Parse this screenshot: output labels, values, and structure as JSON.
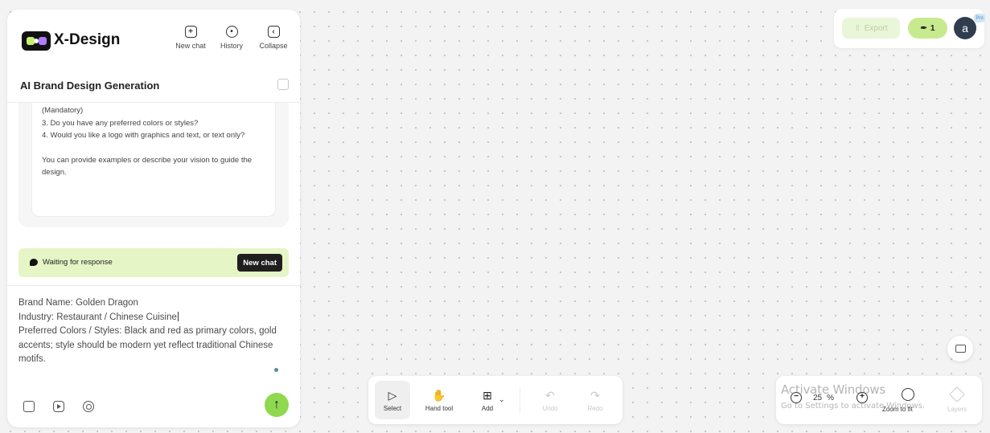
{
  "header": {
    "brand": "X-Design",
    "new_chat": "New chat",
    "history": "History",
    "collapse": "Collapse"
  },
  "conversation": {
    "title": "AI Brand Design Generation",
    "message_lines": [
      "(Mandatory)",
      "3. Do you have any preferred colors or styles?",
      "4. Would you like a logo with graphics and text, or text only?",
      "",
      "You can provide examples or describe your vision to guide the design."
    ]
  },
  "status": {
    "text": "Waiting for response",
    "new_chat_button": "New chat"
  },
  "input": {
    "lines": [
      "Brand Name: Golden Dragon",
      "Industry: Restaurant / Chinese Cuisine",
      "Preferred Colors / Styles: Black and red as primary colors, gold accents; style should be modern yet reflect traditional Chinese motifs."
    ]
  },
  "topbar": {
    "export": "Export",
    "credits": "1",
    "avatar_initial": "a",
    "badge": "Pro"
  },
  "toolbar": {
    "select": "Select",
    "hand": "Hand tool",
    "add": "Add",
    "undo": "Undo",
    "redo": "Redo"
  },
  "zoom": {
    "value": "25",
    "unit": "%",
    "fit": "Zoom to fit",
    "layers": "Layers"
  },
  "watermark": {
    "title": "Activate Windows",
    "subtitle": "Go to Settings to activate Windows."
  },
  "colors": {
    "accent_green": "#8fd84f",
    "status_bg": "#e6f5c6",
    "credits_bg": "#c7ea8e"
  }
}
